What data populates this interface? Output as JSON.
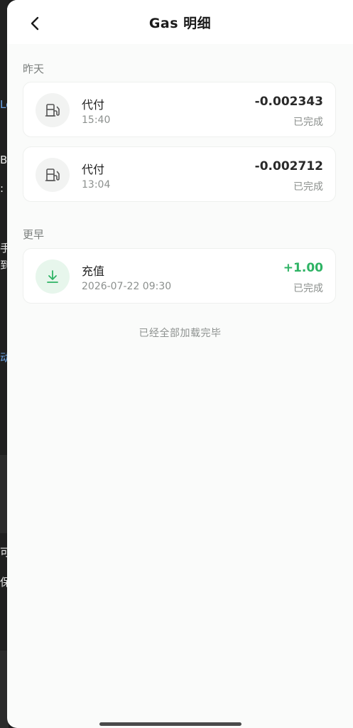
{
  "nav": {
    "title": "Gas 明细"
  },
  "sections": [
    {
      "label": "昨天",
      "items": [
        {
          "title": "代付",
          "time": "15:40",
          "amount": "-0.002343",
          "status": "已完成",
          "icon": "gas-pump-icon"
        },
        {
          "title": "代付",
          "time": "13:04",
          "amount": "-0.002712",
          "status": "已完成",
          "icon": "gas-pump-icon"
        }
      ]
    },
    {
      "label": "更早",
      "items": [
        {
          "title": "充值",
          "time": "2026-07-22 09:30",
          "amount": "+1.00",
          "status": "已完成",
          "icon": "deposit-arrow-icon"
        }
      ]
    }
  ],
  "footer": {
    "end_text": "已经全部加载完毕"
  },
  "colors": {
    "positive": "#2eb364",
    "muted": "#8c908e"
  },
  "background_app": {
    "fragments": [
      "Lo",
      "B",
      ":",
      "手",
      "到",
      "动",
      "可",
      "保"
    ]
  }
}
